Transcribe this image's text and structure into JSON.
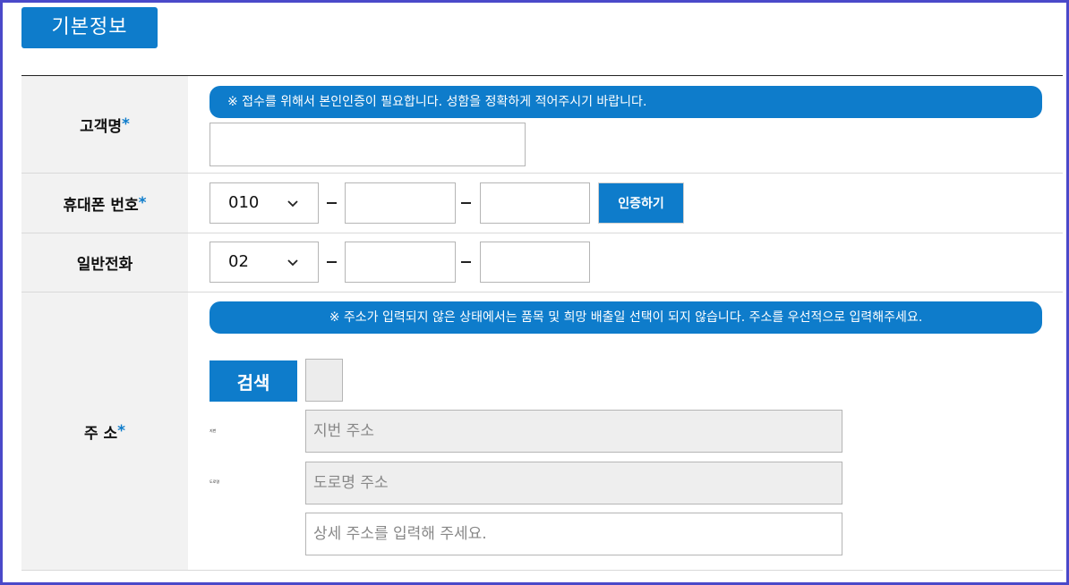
{
  "section": {
    "title": "기본정보"
  },
  "fields": {
    "name": {
      "label": "고객명",
      "required_mark": "*",
      "notice": "※ 접수를 위해서 본인인증이 필요합니다. 성함을 정확하게 적어주시기 바랍니다.",
      "value": ""
    },
    "mobile": {
      "label": "휴대폰 번호",
      "required_mark": "*",
      "prefix": "010",
      "separator": "–",
      "middle": "",
      "last": "",
      "verify_button": "인증하기"
    },
    "phone": {
      "label": "일반전화",
      "prefix": "02",
      "separator": "–",
      "middle": "",
      "last": ""
    },
    "address": {
      "label": "주 소",
      "required_mark": "*",
      "notice": "※ 주소가 입력되지 않은 상태에서는 품목 및 희망 배출일 선택이 되지 않습니다. 주소를 우선적으로 입력해주세요.",
      "search_button": "검색",
      "zipcode": "",
      "jibun_tag": "지번",
      "jibun_placeholder": "지번 주소",
      "road_tag": "도로명",
      "road_placeholder": "도로명 주소",
      "detail_placeholder": "상세 주소를 입력해 주세요."
    }
  },
  "colors": {
    "accent": "#0e7ccb",
    "frame": "#4a49c9",
    "label_bg": "#f2f2f2"
  },
  "icons": {
    "select_arrow": "chevron-down-icon"
  }
}
